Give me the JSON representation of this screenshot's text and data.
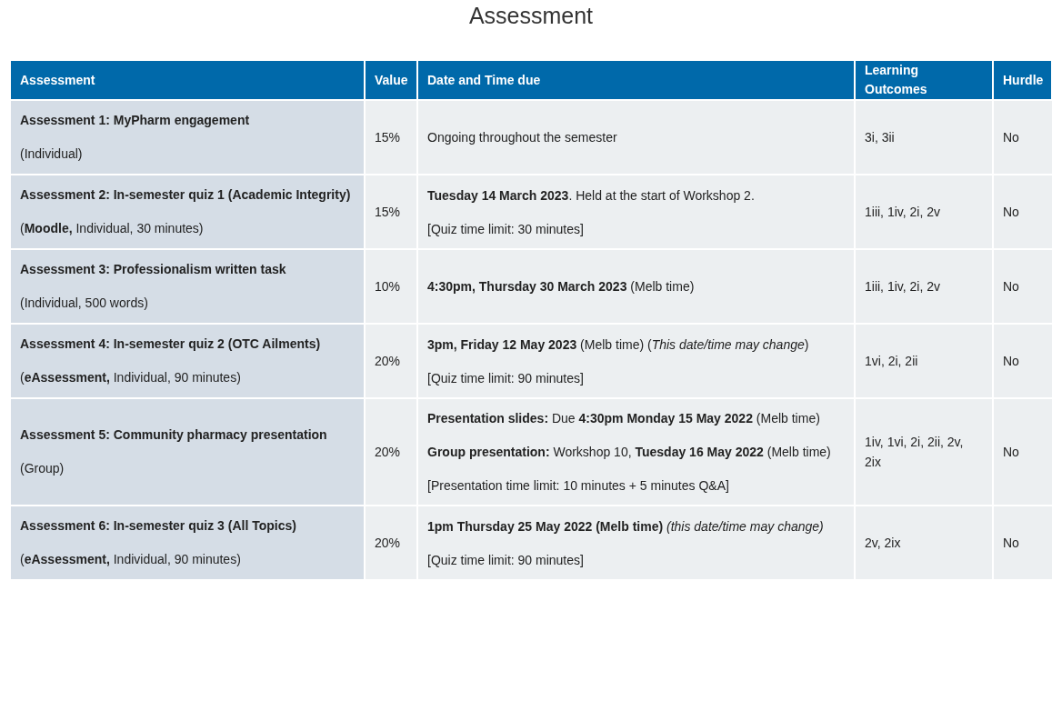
{
  "title": "Assessment",
  "table": {
    "columns": [
      "Assessment",
      "Value",
      "Date and Time due",
      "Learning Outcomes",
      "Hurdle"
    ],
    "rows": [
      {
        "assessment": [
          "Assessment 1: MyPharm engagement",
          "(Individual)"
        ],
        "value": "15%",
        "due": [
          "Ongoing throughout the semester"
        ],
        "outcomes": "3i, 3ii",
        "hurdle": "No"
      },
      {
        "assessment": [
          "Assessment 2: In-semester quiz 1 (Academic Integrity)",
          "(**Moodle,** Individual, 30 minutes)"
        ],
        "value": "15%",
        "due": [
          "**Tuesday 14 March 2023**. Held at the start of Workshop 2.",
          "[Quiz time limit: 30 minutes]"
        ],
        "outcomes": "1iii, 1iv, 2i, 2v",
        "hurdle": "No"
      },
      {
        "assessment": [
          "Assessment 3: Professionalism written task",
          "(Individual, 500 words)"
        ],
        "value": "10%",
        "due": [
          "**4:30pm, Thursday 30 March 2023** (Melb time)"
        ],
        "outcomes": "1iii, 1iv, 2i, 2v",
        "hurdle": "No"
      },
      {
        "assessment": [
          "Assessment 4: In-semester quiz 2 (OTC Ailments)",
          "(**eAssessment,** Individual, 90 minutes)"
        ],
        "value": "20%",
        "due": [
          "**3pm, Friday 12 May 2023** (Melb time) (*This date/time may change*)",
          "[Quiz time limit: 90 minutes]"
        ],
        "outcomes": "1vi, 2i, 2ii",
        "hurdle": "No"
      },
      {
        "assessment": [
          "Assessment 5: Community pharmacy presentation",
          "(Group)"
        ],
        "value": "20%",
        "due": [
          "**Presentation slides:** Due **4:30pm Monday 15 May 2022** (Melb time)",
          "**Group presentation:** Workshop 10, **Tuesday 16 May 2022** (Melb time)",
          "[Presentation time limit: 10 minutes + 5 minutes Q&A]"
        ],
        "outcomes": "1iv, 1vi, 2i, 2ii, 2v, 2ix",
        "hurdle": "No"
      },
      {
        "assessment": [
          "Assessment 6: In-semester quiz 3 (All Topics)",
          "(**eAssessment,** Individual, 90 minutes)"
        ],
        "value": "20%",
        "due": [
          "**1pm Thursday 25 May 2022 (Melb time)** *(this date/time may change)*",
          "[Quiz time limit: 90 minutes]"
        ],
        "outcomes": "2v, 2ix",
        "hurdle": "No"
      }
    ]
  }
}
